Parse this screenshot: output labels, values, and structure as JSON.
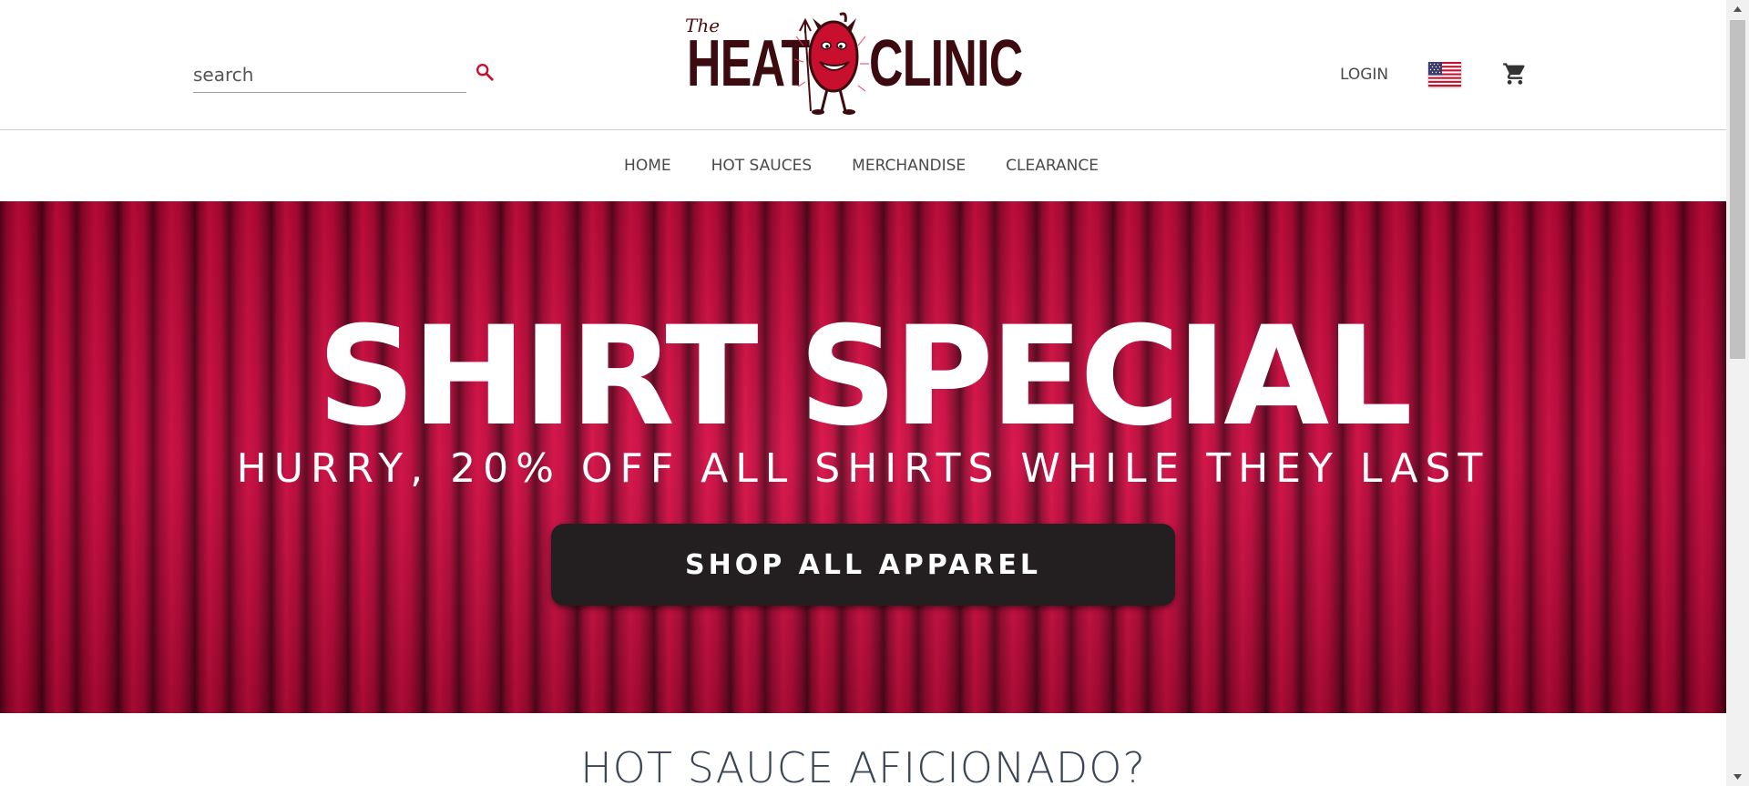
{
  "header": {
    "search": {
      "placeholder": "search",
      "value": ""
    },
    "logo": {
      "the": "The",
      "word1": "HEAT",
      "word2": "CLINIC"
    },
    "login_label": "LOGIN"
  },
  "nav": {
    "items": [
      {
        "label": "HOME"
      },
      {
        "label": "HOT SAUCES"
      },
      {
        "label": "MERCHANDISE"
      },
      {
        "label": "CLEARANCE"
      }
    ]
  },
  "hero": {
    "title": "SHIRT SPECIAL",
    "subtitle": "HURRY, 20% OFF ALL SHIRTS WHILE THEY LAST",
    "cta_label": "SHOP ALL APPAREL"
  },
  "section": {
    "title": "HOT SAUCE AFICIONADO?"
  },
  "colors": {
    "accent": "#c8102e",
    "logo_dark": "#3c0b10",
    "hero_red": "#d70a45",
    "cta_bg": "#231f20"
  },
  "icons": {
    "search": "search-icon",
    "flag": "us-flag-icon",
    "cart": "shopping-cart-icon"
  }
}
